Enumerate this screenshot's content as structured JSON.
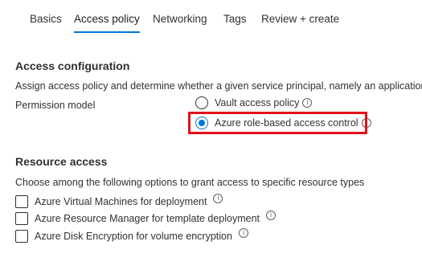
{
  "tabs": [
    {
      "label": "Basics",
      "active": false
    },
    {
      "label": "Access policy",
      "active": true
    },
    {
      "label": "Networking",
      "active": false
    },
    {
      "label": "Tags",
      "active": false
    },
    {
      "label": "Review + create",
      "active": false
    }
  ],
  "access_configuration": {
    "heading": "Access configuration",
    "description": "Assign access policy and determine whether a given service principal, namely an application or use",
    "permission_model_label": "Permission model",
    "options": [
      {
        "label": "Vault access policy",
        "selected": false,
        "info_icon": "info-icon"
      },
      {
        "label": "Azure role-based access control",
        "selected": true,
        "info_icon": "info-icon"
      }
    ],
    "highlight_color": "#e3111b"
  },
  "resource_access": {
    "heading": "Resource access",
    "description": "Choose among the following options to grant access to specific resource types",
    "options": [
      {
        "label": "Azure Virtual Machines for deployment",
        "checked": false,
        "info_icon": "info-icon"
      },
      {
        "label": "Azure Resource Manager for template deployment",
        "checked": false,
        "info_icon": "info-icon"
      },
      {
        "label": "Azure Disk Encryption for volume encryption",
        "checked": false,
        "info_icon": "info-icon"
      }
    ]
  },
  "colors": {
    "accent": "#0078d4",
    "text": "#323130"
  }
}
